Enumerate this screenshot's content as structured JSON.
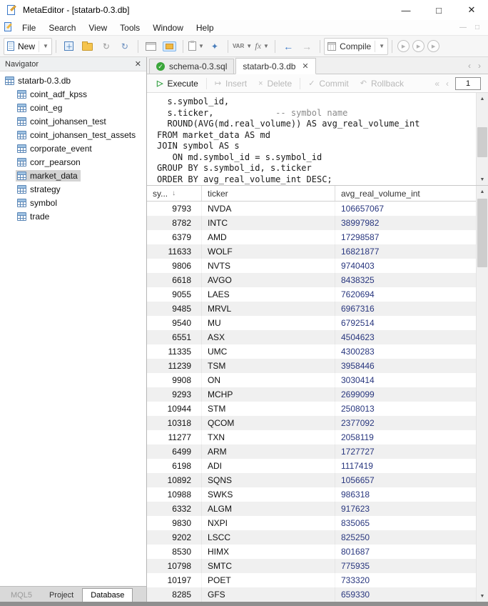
{
  "window": {
    "title": "MetaEditor - [statarb-0.3.db]",
    "controls": {
      "minimize": "—",
      "maximize": "□",
      "close": "✕"
    }
  },
  "menu": {
    "items": [
      "File",
      "Search",
      "View",
      "Tools",
      "Window",
      "Help"
    ]
  },
  "toolbar": {
    "new_label": "New",
    "var_label": "VAR",
    "fx_label": "fx",
    "compile_label": "Compile"
  },
  "navigator": {
    "title": "Navigator",
    "root": "statarb-0.3.db",
    "items": [
      "coint_adf_kpss",
      "coint_eg",
      "coint_johansen_test",
      "coint_johansen_test_assets",
      "corporate_event",
      "corr_pearson",
      "market_data",
      "strategy",
      "symbol",
      "trade"
    ],
    "selected": "market_data",
    "bottom_tabs": [
      "MQL5",
      "Project",
      "Database"
    ],
    "active_bottom_tab": "Database"
  },
  "editor_tabs": [
    {
      "label": "schema-0.3.sql",
      "active": false
    },
    {
      "label": "statarb-0.3.db",
      "active": true
    }
  ],
  "db_toolbar": {
    "execute": "Execute",
    "insert": "Insert",
    "delete": "Delete",
    "commit": "Commit",
    "rollback": "Rollback",
    "page_value": "1"
  },
  "sql": {
    "lines": [
      "  s.symbol_id,",
      "  s.ticker,            -- symbol name",
      "  ROUND(AVG(md.real_volume)) AS avg_real_volume_int",
      "FROM market_data AS md",
      "JOIN symbol AS s",
      "   ON md.symbol_id = s.symbol_id",
      "GROUP BY s.symbol_id, s.ticker",
      "ORDER BY avg_real_volume_int DESC;"
    ]
  },
  "results": {
    "columns": [
      "sy...",
      "ticker",
      "avg_real_volume_int"
    ],
    "rows": [
      [
        9793,
        "NVDA",
        106657067
      ],
      [
        8782,
        "INTC",
        38997982
      ],
      [
        6379,
        "AMD",
        17298587
      ],
      [
        11633,
        "WOLF",
        16821877
      ],
      [
        9806,
        "NVTS",
        9740403
      ],
      [
        6618,
        "AVGO",
        8438325
      ],
      [
        9055,
        "LAES",
        7620694
      ],
      [
        9485,
        "MRVL",
        6967316
      ],
      [
        9540,
        "MU",
        6792514
      ],
      [
        6551,
        "ASX",
        4504623
      ],
      [
        11335,
        "UMC",
        4300283
      ],
      [
        11239,
        "TSM",
        3958446
      ],
      [
        9908,
        "ON",
        3030414
      ],
      [
        9293,
        "MCHP",
        2699099
      ],
      [
        10944,
        "STM",
        2508013
      ],
      [
        10318,
        "QCOM",
        2377092
      ],
      [
        11277,
        "TXN",
        2058119
      ],
      [
        6499,
        "ARM",
        1727727
      ],
      [
        6198,
        "ADI",
        1117419
      ],
      [
        10892,
        "SQNS",
        1056657
      ],
      [
        10988,
        "SWKS",
        986318
      ],
      [
        6332,
        "ALGM",
        917623
      ],
      [
        9830,
        "NXPI",
        835065
      ],
      [
        9202,
        "LSCC",
        825250
      ],
      [
        8530,
        "HIMX",
        801687
      ],
      [
        10798,
        "SMTC",
        775935
      ],
      [
        10197,
        "POET",
        733320
      ],
      [
        8285,
        "GFS",
        659330
      ]
    ]
  },
  "colors": {
    "accent_green": "#2f9e3f",
    "row_alt": "#f0f0f0",
    "volume_text": "#28367e",
    "table_icon_blue": "#5b87b7"
  }
}
